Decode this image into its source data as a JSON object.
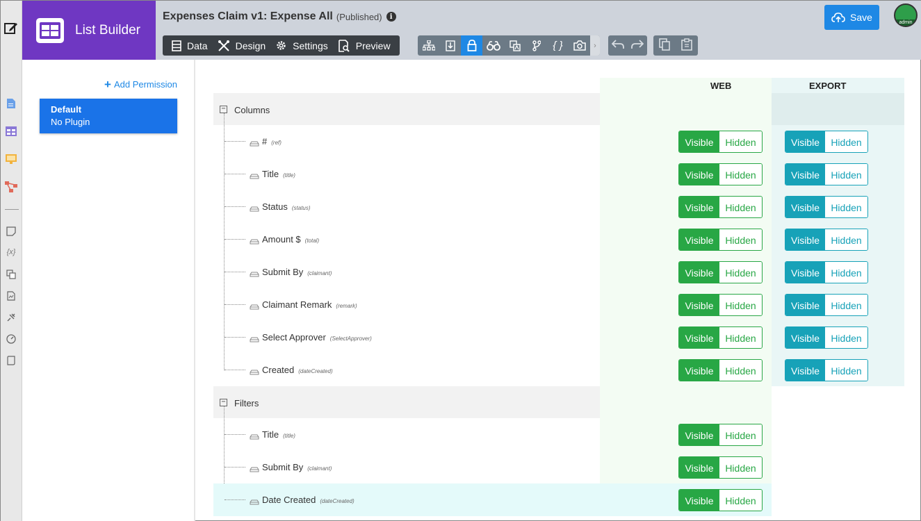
{
  "app": {
    "name": "List Builder",
    "doc_title": "Expenses Claim v1: Expense All",
    "doc_status": "(Published)"
  },
  "toolbar": {
    "tabs": [
      {
        "label": "Data",
        "icon": "table-icon"
      },
      {
        "label": "Design",
        "icon": "tools-icon"
      },
      {
        "label": "Settings",
        "icon": "gear-icon"
      },
      {
        "label": "Preview",
        "icon": "preview-icon"
      }
    ],
    "save_label": "Save",
    "avatar_label": "admin"
  },
  "permissions": {
    "add_label": "Add Permission",
    "items": [
      {
        "name": "Default",
        "plugin": "No Plugin"
      }
    ]
  },
  "grid": {
    "col_web": "WEB",
    "col_export": "EXPORT",
    "toggle_on": "Visible",
    "toggle_off": "Hidden",
    "sections": [
      {
        "label": "Columns",
        "rows": [
          {
            "label": "#",
            "ref": "(ref)"
          },
          {
            "label": "Title",
            "ref": "(title)"
          },
          {
            "label": "Status",
            "ref": "(status)"
          },
          {
            "label": "Amount $",
            "ref": "(total)"
          },
          {
            "label": "Submit By",
            "ref": "(claimant)"
          },
          {
            "label": "Claimant Remark",
            "ref": "(remark)"
          },
          {
            "label": "Select Approver",
            "ref": "(SelectApprover)"
          },
          {
            "label": "Created",
            "ref": "(dateCreated)"
          }
        ]
      },
      {
        "label": "Filters",
        "rows": [
          {
            "label": "Title",
            "ref": "(title)"
          },
          {
            "label": "Submit By",
            "ref": "(claimant)"
          },
          {
            "label": "Date Created",
            "ref": "(dateCreated)"
          }
        ]
      }
    ]
  },
  "colors": {
    "brand": "#6f37c2",
    "primary": "#1e88e5",
    "visible_web": "#28a745",
    "visible_export": "#17a2b8"
  }
}
